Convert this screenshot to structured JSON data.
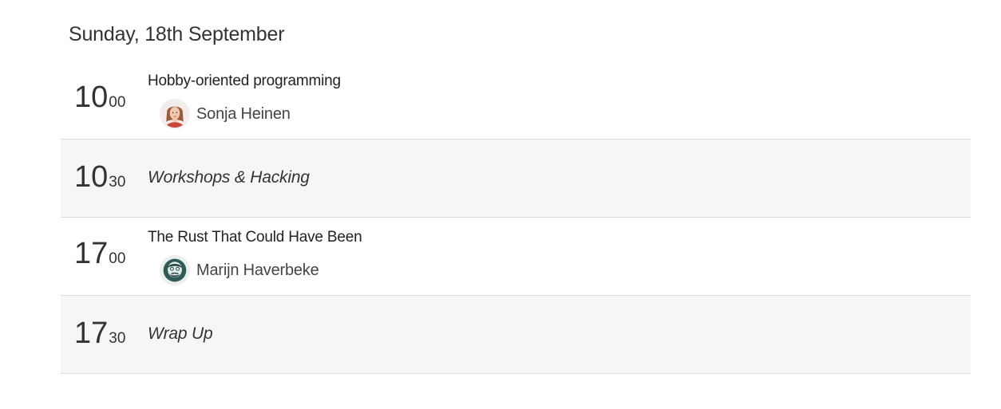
{
  "day": {
    "title": "Sunday, 18th September"
  },
  "slots": [
    {
      "type": "talk",
      "hour": "10",
      "minutes": "00",
      "title": "Hobby-oriented programming",
      "speaker": "Sonja Heinen"
    },
    {
      "type": "break",
      "hour": "10",
      "minutes": "30",
      "title": "Workshops & Hacking"
    },
    {
      "type": "talk",
      "hour": "17",
      "minutes": "00",
      "title": "The Rust That Could Have Been",
      "speaker": "Marijn Haverbeke"
    },
    {
      "type": "break",
      "hour": "17",
      "minutes": "30",
      "title": "Wrap Up"
    }
  ],
  "colors": {
    "break_background": "#f6f6f6",
    "divider": "#dcdcdc",
    "text": "#333333"
  }
}
